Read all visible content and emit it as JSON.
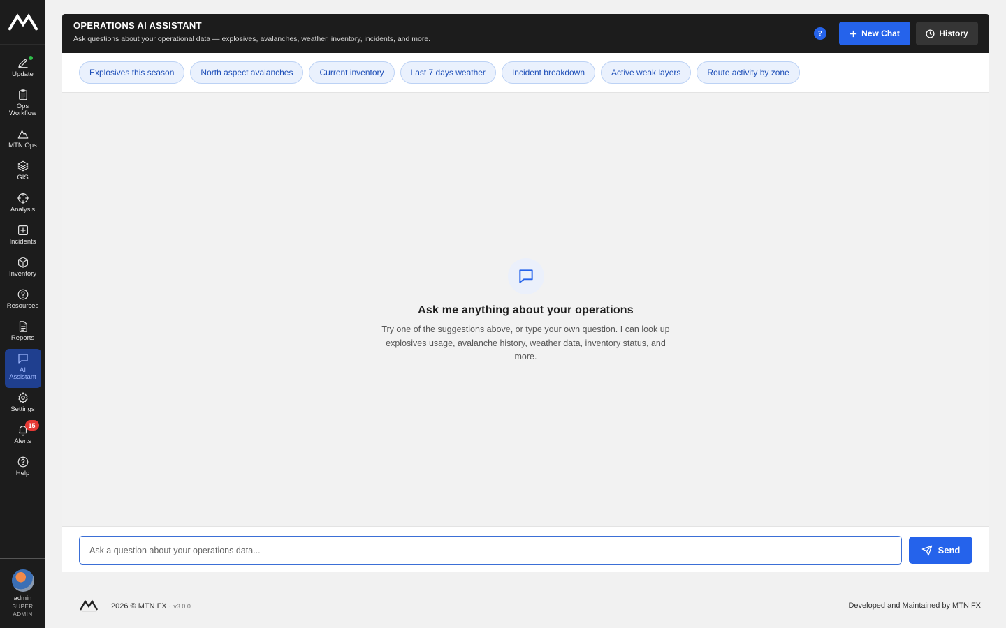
{
  "sidebar": {
    "logo": "mtn-logo",
    "items": [
      {
        "key": "update",
        "label": "Update",
        "icon": "pencil-icon",
        "status_dot": "#2fbf4a"
      },
      {
        "key": "ops-workflow",
        "label": "Ops\nWorkflow",
        "icon": "clipboard-icon"
      },
      {
        "key": "mtn-ops",
        "label": "MTN Ops",
        "icon": "mountain-icon"
      },
      {
        "key": "gis",
        "label": "GIS",
        "icon": "layers-icon"
      },
      {
        "key": "analysis",
        "label": "Analysis",
        "icon": "crosshair-icon"
      },
      {
        "key": "incidents",
        "label": "Incidents",
        "icon": "plus-square-icon"
      },
      {
        "key": "inventory",
        "label": "Inventory",
        "icon": "box-icon"
      },
      {
        "key": "resources",
        "label": "Resources",
        "icon": "question-circle-icon"
      },
      {
        "key": "reports",
        "label": "Reports",
        "icon": "document-icon"
      },
      {
        "key": "ai-assistant",
        "label": "AI\nAssistant",
        "icon": "chat-icon",
        "active": true
      },
      {
        "key": "settings",
        "label": "Settings",
        "icon": "gear-icon"
      },
      {
        "key": "alerts",
        "label": "Alerts",
        "icon": "bell-icon",
        "badge": "15"
      },
      {
        "key": "help",
        "label": "Help",
        "icon": "help-circle-icon"
      }
    ],
    "user": {
      "name": "admin",
      "role": "SUPER\nADMIN"
    }
  },
  "header": {
    "title": "OPERATIONS AI ASSISTANT",
    "subtitle": "Ask questions about your operational data — explosives, avalanches, weather, inventory, incidents, and more.",
    "help_label": "?",
    "new_chat_label": "New Chat",
    "history_label": "History",
    "accent": "#2563eb"
  },
  "suggestions": [
    "Explosives this season",
    "North aspect avalanches",
    "Current inventory",
    "Last 7 days weather",
    "Incident breakdown",
    "Active weak layers",
    "Route activity by zone"
  ],
  "empty_state": {
    "title": "Ask me anything about your operations",
    "text": "Try one of the suggestions above, or type your own question. I can look up explosives usage, avalanche history, weather data, inventory status, and more."
  },
  "composer": {
    "placeholder": "Ask a question about your operations data...",
    "value": "",
    "send_label": "Send"
  },
  "footer": {
    "copyright": "2026 © MTN FX · ",
    "version": "v3.0.0",
    "credit": "Developed and Maintained by MTN FX"
  }
}
